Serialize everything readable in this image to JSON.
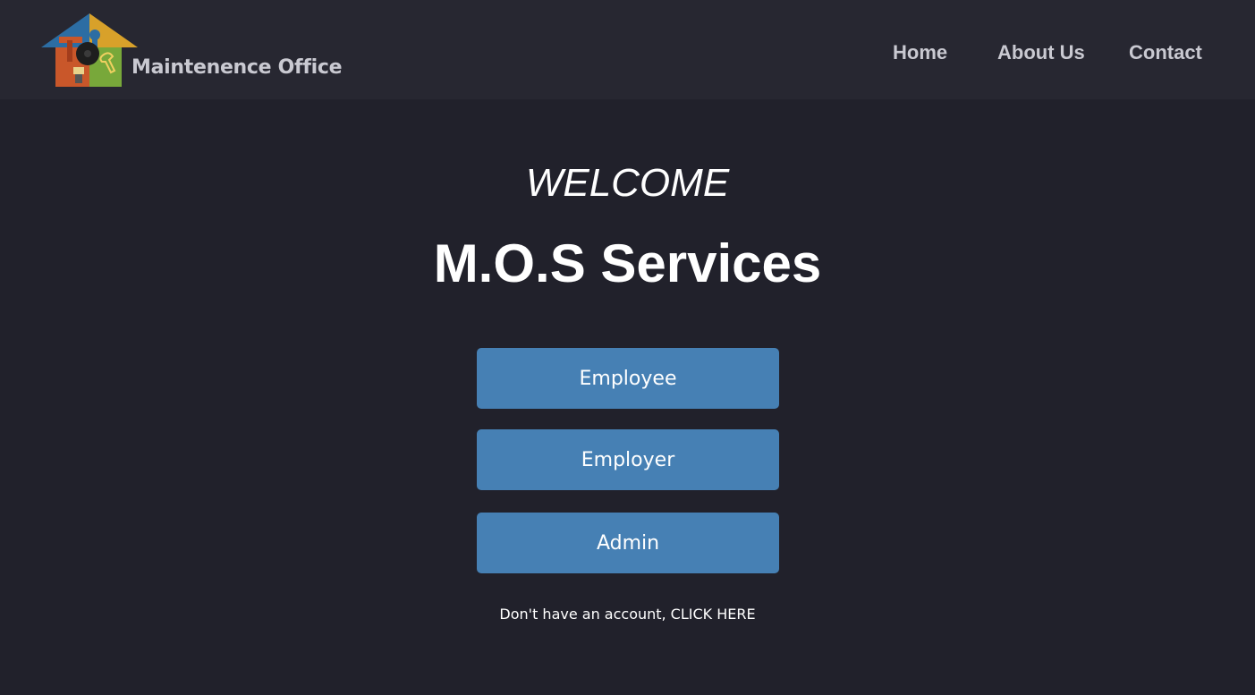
{
  "header": {
    "brand_name": "Maintenence Office",
    "logo_icon": "house-tools-logo",
    "nav": {
      "home": "Home",
      "about": "About Us",
      "contact": "Contact"
    }
  },
  "hero": {
    "welcome": "WELCOME",
    "title": "M.O.S Services"
  },
  "login_options": {
    "employee": "Employee",
    "employer": "Employer",
    "admin": "Admin"
  },
  "signup": {
    "prompt": "Don't have an account,",
    "link": "CLICK HERE"
  },
  "colors": {
    "page_background": "#21212b",
    "navbar_background": "#272731",
    "button_background": "#4680b4",
    "nav_text": "#c9c9d1",
    "text": "#ffffff"
  }
}
